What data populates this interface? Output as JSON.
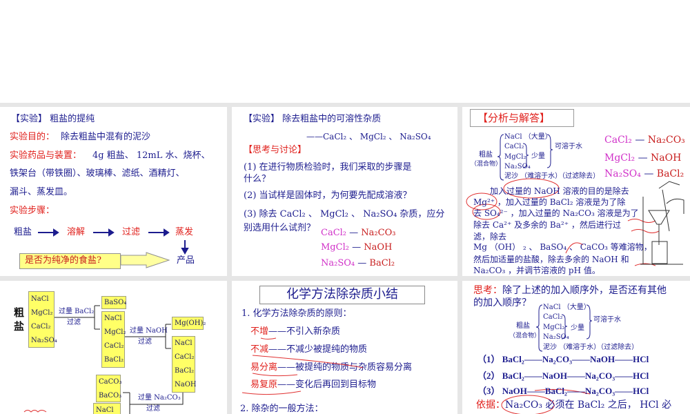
{
  "s1": {
    "title": "【实验】 粗盐的提纯",
    "purpose_label": "实验目的：",
    "purpose": "除去粗盐中混有的泥沙",
    "materials_label": "实验药品与装置：",
    "materials_1": "4g 粗盐、 12mL 水、烧杯、",
    "materials_2": "铁架台（带铁圈）、玻璃棒、滤纸、酒精灯、",
    "materials_3": "漏斗、蒸发皿。",
    "steps_label": "实验步骤：",
    "flow": [
      "粗盐",
      "溶解",
      "过滤",
      "蒸发"
    ],
    "product": "产品",
    "question": "是否为纯净的食盐?"
  },
  "s2": {
    "title": "【实验】 除去粗盐中的可溶性杂质",
    "subtitle": "——CaCl₂ 、 MgCl₂ 、 Na₂SO₄",
    "discuss": "【思考与讨论】",
    "q1a": "(1) 在进行物质检验时，我们采取的步骤是",
    "q1b": "什么？",
    "q2": "(2) 当试样是固体时，为何要先配成溶液？",
    "q3a": "(3) 除去 CaCl₂ 、 MgCl₂ 、 Na₂SO₄ 杂质，应分",
    "q3b": "别选用什么试剂？",
    "pairs": [
      [
        "CaCl₂",
        "Na₂CO₃"
      ],
      [
        "MgCl₂",
        "NaOH"
      ],
      [
        "Na₂SO₄",
        "BaCl₂"
      ]
    ],
    "dash": "—"
  },
  "s3": {
    "title": "【分析与解答】",
    "crude": "粗盐",
    "mixture": "（混合物）",
    "items": [
      "NaCl （大量）",
      "CaCl₂",
      "MgCl₂",
      "Na₂SO₄",
      "泥沙 （难溶于水）（过滤除去）"
    ],
    "small": "少量",
    "soluble": "可溶于水",
    "pairs": [
      [
        "CaCl₂",
        "Na₂CO₃"
      ],
      [
        "MgCl₂",
        "NaOH"
      ],
      [
        "Na₂SO₄",
        "BaCl₂"
      ]
    ],
    "dash": "—",
    "para": [
      "　　加入过量的 NaOH 溶液的目的是除去",
      "Mg²⁺ ，加入过量的 BaCl₂ 溶液是为了除",
      "去 SO₄²⁻ ，加入过量的 Na₂CO₃ 溶液是为了",
      "除去 Ca²⁺ 及多余的 Ba²⁺ ，然后进行过",
      "滤，除去",
      "Mg （OH） ₂ 、 BaSO₄ 、 CaCO₃ 等难溶物，",
      "然后加适量的盐酸，除去多余的 NaOH 和",
      "Na₂CO₃ ，并调节溶液的 pH 值。"
    ]
  },
  "s4": {
    "crude": [
      "粗",
      "盐"
    ],
    "box_a": [
      "NaCl",
      "MgCl₂",
      "CaCl₂",
      "Na₂SO₄"
    ],
    "step1": [
      "过量 BaCl₂",
      "过滤"
    ],
    "ppt1": "BaSO₄",
    "box_b": [
      "NaCl",
      "MgCl₂",
      "CaCl₂",
      "BaCl₂"
    ],
    "step2": [
      "过量 NaOH",
      "过滤"
    ],
    "ppt2": "Mg(OH)₂",
    "box_c": [
      "NaCl",
      "CaCl₂",
      "BaCl₂",
      "NaOH"
    ],
    "step3": [
      "过量 Na₂CO₃",
      "过滤"
    ],
    "ppt3": [
      "CaCO₃",
      "BaCO₃"
    ],
    "box_d": [
      "NaCl"
    ]
  },
  "s5": {
    "title": "化学方法除杂质小结",
    "h1": "1. 化学方法除杂质的原则：",
    "rules": [
      [
        "不增",
        "——不引入新杂质"
      ],
      [
        "不减",
        "——不减少被提纯的物质"
      ],
      [
        "易分离",
        "——被提纯的物质与杂质容易分离"
      ],
      [
        "易复原",
        "——变化后再回到目标物"
      ]
    ],
    "h2": "2. 除杂的一般方法："
  },
  "s6": {
    "think_label": "思考：",
    "think_1": "除了上述的加入顺序外，是否还有其他",
    "think_2": "的加入顺序？",
    "crude": "粗盐",
    "mixture": "（混合物）",
    "items": [
      "NaCl （大量）",
      "CaCl₂",
      "MgCl₂",
      "Na₂SO₄",
      "泥沙 （难溶于水）（过滤除去）"
    ],
    "small": "少量",
    "soluble": "可溶于水",
    "orders": [
      "（1） BaCl₂——Na₂CO₃——NaOH——HCl",
      "（2） BaCl₂——NaOH——Na₂CO₃——HCl",
      "（3） NaOH——BaCl₂——Na₂CO₃——HCl"
    ],
    "basis_label": "依据：",
    "basis": "Na₂CO₃ 必须在 BaCl₂ 之后， HCl 必"
  }
}
